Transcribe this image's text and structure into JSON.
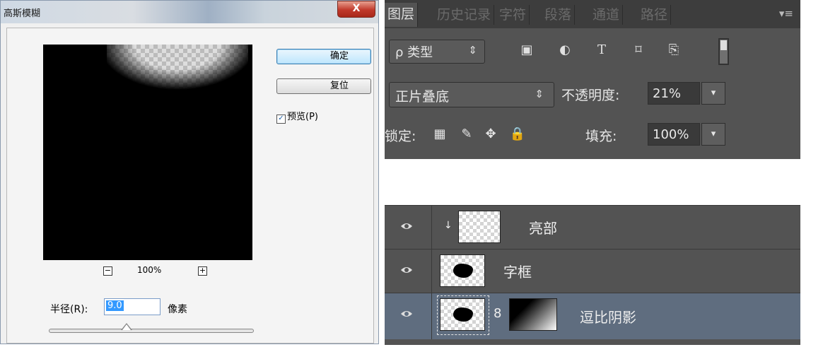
{
  "dialog": {
    "title": "高斯模糊",
    "close_label": "X",
    "ok_label": "确定",
    "reset_label": "复位",
    "preview_checkbox": {
      "checked": true,
      "check_glyph": "✓",
      "label": "预览(P)"
    },
    "zoom": {
      "minus": "−",
      "value": "100%",
      "plus": "+"
    },
    "radius": {
      "label": "半径(R):",
      "value": "9.0",
      "unit": "像素"
    }
  },
  "layers_panel": {
    "tabs": [
      "图层",
      "历史记录",
      "字符",
      "段落",
      "通道",
      "路径"
    ],
    "active_tab": "图层",
    "menu_icon": "▾≡",
    "filter": {
      "label": "ρ 类型",
      "arrow": "⇕"
    },
    "filter_icons": [
      "image-icon",
      "adjustment-icon",
      "type-icon",
      "shape-icon",
      "smart-object-icon"
    ],
    "filter_glyphs": {
      "image": "▣",
      "adjustment": "◐",
      "type": "T",
      "shape": "⌑",
      "smart": "⎘"
    },
    "blend_mode": {
      "label": "正片叠底",
      "arrow": "⇕"
    },
    "opacity": {
      "label": "不透明度:",
      "value": "21%"
    },
    "lock": {
      "label": "锁定:",
      "glyphs": {
        "pixels": "▦",
        "paint": "✎",
        "move": "✥",
        "all": "🔒"
      }
    },
    "fill": {
      "label": "填充:",
      "value": "100%"
    },
    "dropdown_arrow": "▾",
    "layers": [
      {
        "name": "亮部",
        "clip_glyph": "↓",
        "selected": false
      },
      {
        "name": "字框",
        "selected": false
      },
      {
        "name": "逗比阴影",
        "link_glyph": "8",
        "selected": true
      }
    ]
  }
}
